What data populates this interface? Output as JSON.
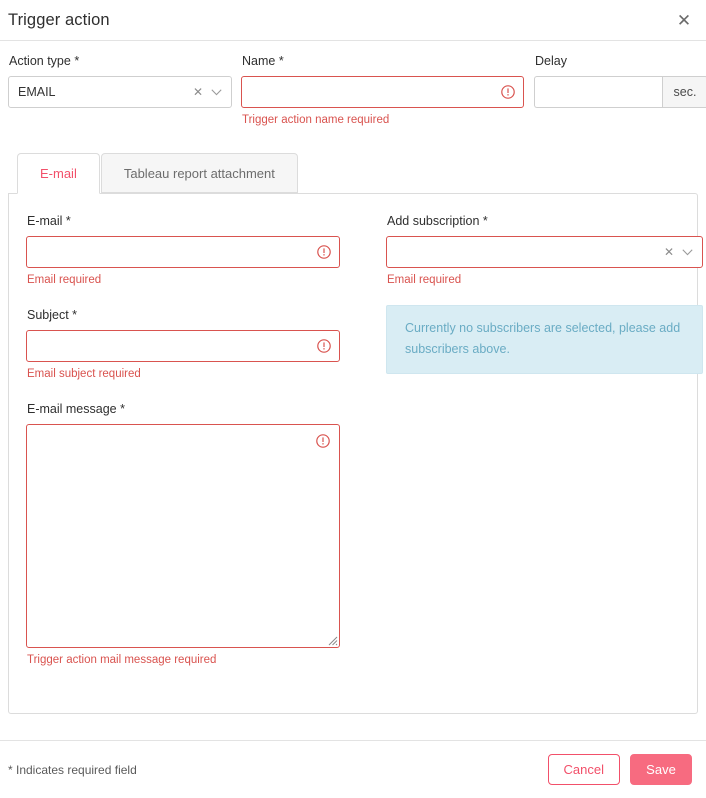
{
  "dialog": {
    "title": "Trigger action",
    "close_icon": "close-icon"
  },
  "form": {
    "action_type": {
      "label": "Action type *",
      "value": "EMAIL",
      "clear_icon": "clear-icon",
      "chevron_icon": "chevron-down-icon"
    },
    "name": {
      "label": "Name *",
      "value": "",
      "error": "Trigger action name required",
      "error_icon": "error-icon"
    },
    "delay": {
      "label": "Delay",
      "value": "",
      "unit": "sec."
    }
  },
  "tabs": [
    {
      "label": "E-mail",
      "active": true
    },
    {
      "label": "Tableau report attachment",
      "active": false
    }
  ],
  "email_tab": {
    "email": {
      "label": "E-mail *",
      "value": "",
      "error": "Email required",
      "error_icon": "error-icon"
    },
    "subject": {
      "label": "Subject *",
      "value": "",
      "error": "Email subject required",
      "error_icon": "error-icon"
    },
    "message": {
      "label": "E-mail message *",
      "value": "",
      "error": "Trigger action mail message required",
      "error_icon": "error-icon"
    },
    "subscription": {
      "label": "Add subscription *",
      "value": "",
      "error": "Email required",
      "clear_icon": "clear-icon",
      "chevron_icon": "chevron-down-icon"
    },
    "info_box": {
      "text": "Currently no subscribers are selected, please add subscribers above."
    }
  },
  "footer": {
    "required_note": "* Indicates required field",
    "cancel_label": "Cancel",
    "save_label": "Save"
  },
  "colors": {
    "accent": "#f2506a",
    "save_bg": "#f76b80",
    "error": "#d9534f",
    "info_bg": "#d9edf4",
    "info_text": "#6aacc4"
  }
}
